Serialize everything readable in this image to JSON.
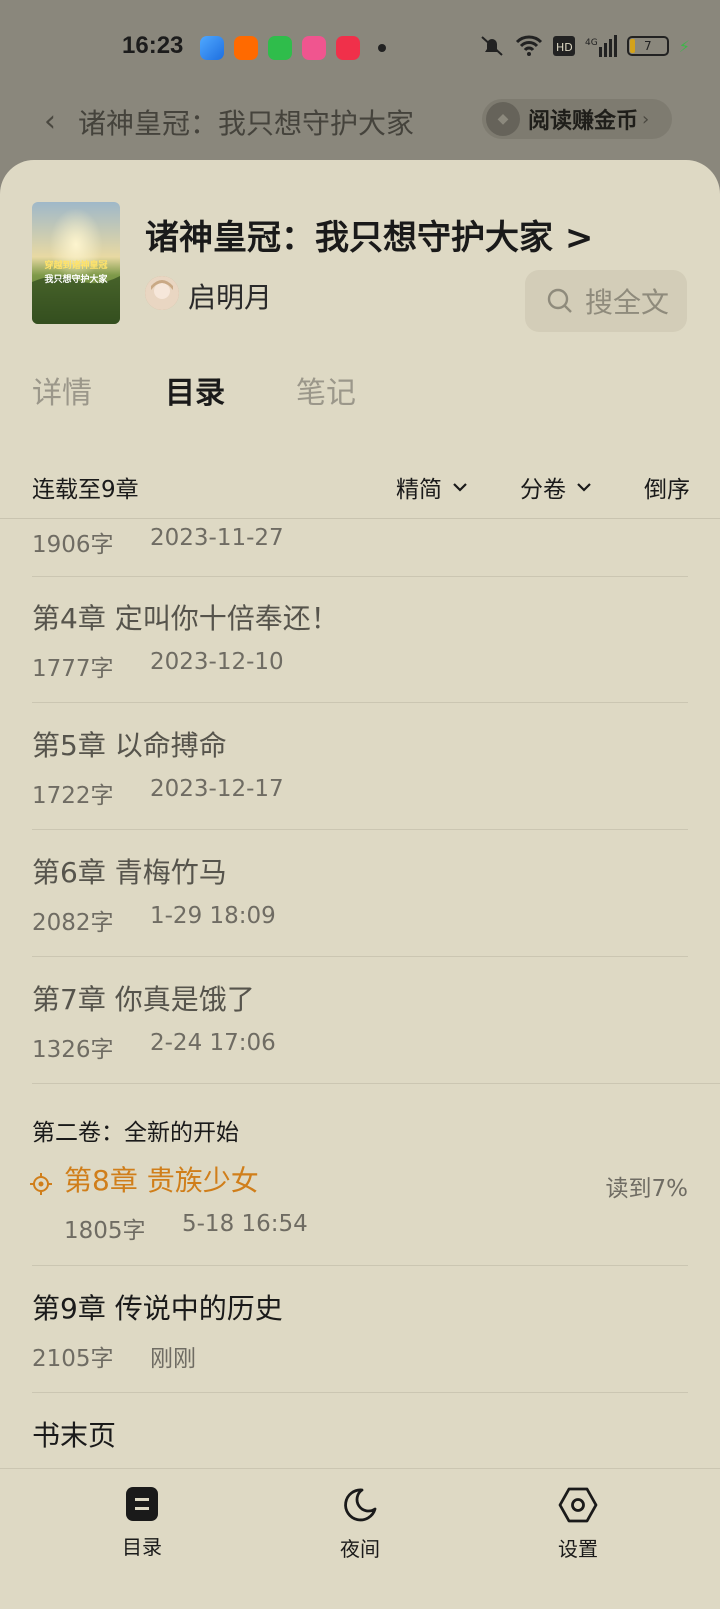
{
  "status_bar": {
    "time": "16:23",
    "battery": "7",
    "network": "4G"
  },
  "header": {
    "title": "诸神皇冠：我只想守护大家",
    "earn_button": "阅读赚金币"
  },
  "book": {
    "cover_text_line1": "穿越到诸神皇冠",
    "cover_text_line2": "我只想守护大家",
    "title": "诸神皇冠：我只想守护大家 >",
    "author": "启明月",
    "search_label": "搜全文"
  },
  "tabs": [
    {
      "label": "详情",
      "active": false
    },
    {
      "label": "目录",
      "active": true
    },
    {
      "label": "笔记",
      "active": false
    }
  ],
  "toolbar": {
    "serial_status": "连载至9章",
    "filter_label": "精简",
    "volume_label": "分卷",
    "order_label": "倒序"
  },
  "chapters_before_volume": [
    {
      "title": "",
      "words": "1906字",
      "date": "2023-11-27"
    },
    {
      "title": "第4章 定叫你十倍奉还！",
      "words": "1777字",
      "date": "2023-12-10"
    },
    {
      "title": "第5章 以命搏命",
      "words": "1722字",
      "date": "2023-12-17"
    },
    {
      "title": "第6章 青梅竹马",
      "words": "2082字",
      "date": "1-29 18:09"
    },
    {
      "title": "第7章 你真是饿了",
      "words": "1326字",
      "date": "2-24 17:06"
    }
  ],
  "volume2": {
    "title": "第二卷：全新的开始",
    "current_chapter": {
      "title": "第8章 贵族少女",
      "words": "1805字",
      "date": "5-18 16:54",
      "progress": "读到7%"
    },
    "chapter9": {
      "title": "第9章 传说中的历史",
      "words": "2105字",
      "date": "刚刚"
    }
  },
  "book_end": "书末页",
  "bottom_bar": [
    {
      "label": "目录",
      "icon": "catalog-icon"
    },
    {
      "label": "夜间",
      "icon": "moon-icon"
    },
    {
      "label": "设置",
      "icon": "settings-icon"
    }
  ],
  "colors": {
    "sheet_bg": "#ded9c4",
    "accent": "#d07e1a",
    "dim_bg": "#8a877c"
  }
}
